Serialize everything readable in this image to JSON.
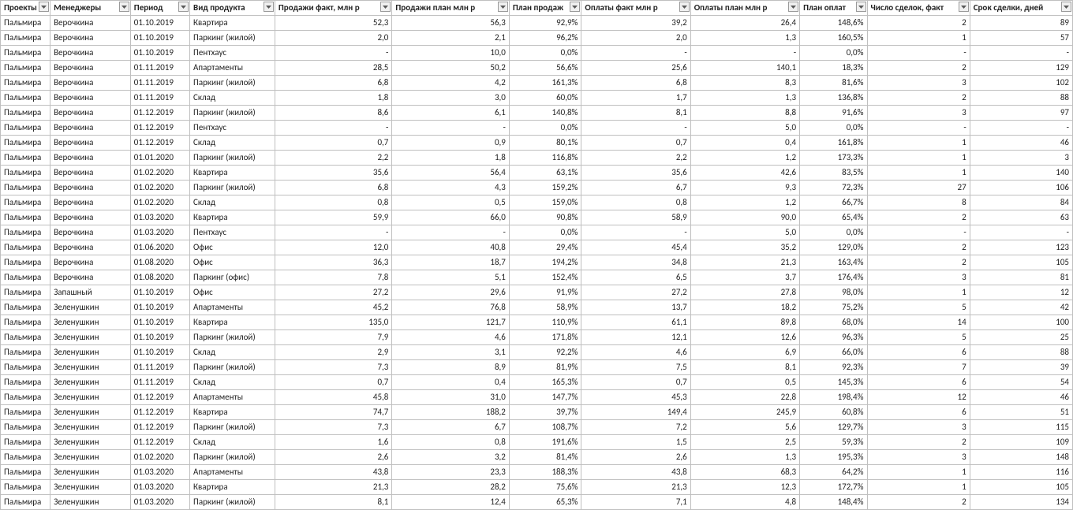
{
  "columns": [
    {
      "key": "project",
      "label": "Проекты",
      "align": "left"
    },
    {
      "key": "manager",
      "label": "Менеджеры",
      "align": "left"
    },
    {
      "key": "period",
      "label": "Период",
      "align": "left"
    },
    {
      "key": "product",
      "label": "Вид продукта",
      "align": "left"
    },
    {
      "key": "sales_fact",
      "label": "Продажи факт, млн р",
      "align": "right"
    },
    {
      "key": "sales_plan",
      "label": "Продажи план млн р",
      "align": "right"
    },
    {
      "key": "sales_pct",
      "label": "План продаж",
      "align": "right"
    },
    {
      "key": "pay_fact",
      "label": "Оплаты факт млн р",
      "align": "right"
    },
    {
      "key": "pay_plan",
      "label": "Оплаты план млн р",
      "align": "right"
    },
    {
      "key": "pay_pct",
      "label": "План оплат",
      "align": "right"
    },
    {
      "key": "deals",
      "label": "Число сделок, факт",
      "align": "right"
    },
    {
      "key": "days",
      "label": "Срок сделки, дней",
      "align": "right"
    }
  ],
  "rows": [
    {
      "project": "Пальмира",
      "manager": "Верочкина",
      "period": "01.10.2019",
      "product": "Квартира",
      "sales_fact": "52,3",
      "sales_plan": "56,3",
      "sales_pct": "92,9%",
      "pay_fact": "39,2",
      "pay_plan": "26,4",
      "pay_pct": "148,6%",
      "deals": "2",
      "days": "89"
    },
    {
      "project": "Пальмира",
      "manager": "Верочкина",
      "period": "01.10.2019",
      "product": "Паркинг (жилой)",
      "sales_fact": "2,0",
      "sales_plan": "2,1",
      "sales_pct": "96,2%",
      "pay_fact": "2,0",
      "pay_plan": "1,3",
      "pay_pct": "160,5%",
      "deals": "1",
      "days": "57"
    },
    {
      "project": "Пальмира",
      "manager": "Верочкина",
      "period": "01.10.2019",
      "product": "Пентхаус",
      "sales_fact": "-",
      "sales_plan": "10,0",
      "sales_pct": "0,0%",
      "pay_fact": "-",
      "pay_plan": "-",
      "pay_pct": "0,0%",
      "deals": "-",
      "days": "-"
    },
    {
      "project": "Пальмира",
      "manager": "Верочкина",
      "period": "01.11.2019",
      "product": "Апартаменты",
      "sales_fact": "28,5",
      "sales_plan": "50,2",
      "sales_pct": "56,6%",
      "pay_fact": "25,6",
      "pay_plan": "140,1",
      "pay_pct": "18,3%",
      "deals": "2",
      "days": "129"
    },
    {
      "project": "Пальмира",
      "manager": "Верочкина",
      "period": "01.11.2019",
      "product": "Паркинг (жилой)",
      "sales_fact": "6,8",
      "sales_plan": "4,2",
      "sales_pct": "161,3%",
      "pay_fact": "6,8",
      "pay_plan": "8,3",
      "pay_pct": "81,6%",
      "deals": "3",
      "days": "102"
    },
    {
      "project": "Пальмира",
      "manager": "Верочкина",
      "period": "01.11.2019",
      "product": "Склад",
      "sales_fact": "1,8",
      "sales_plan": "3,0",
      "sales_pct": "60,0%",
      "pay_fact": "1,7",
      "pay_plan": "1,3",
      "pay_pct": "136,8%",
      "deals": "2",
      "days": "88"
    },
    {
      "project": "Пальмира",
      "manager": "Верочкина",
      "period": "01.12.2019",
      "product": "Паркинг (жилой)",
      "sales_fact": "8,6",
      "sales_plan": "6,1",
      "sales_pct": "140,8%",
      "pay_fact": "8,1",
      "pay_plan": "8,8",
      "pay_pct": "91,6%",
      "deals": "3",
      "days": "97"
    },
    {
      "project": "Пальмира",
      "manager": "Верочкина",
      "period": "01.12.2019",
      "product": "Пентхаус",
      "sales_fact": "-",
      "sales_plan": "-",
      "sales_pct": "0,0%",
      "pay_fact": "-",
      "pay_plan": "5,0",
      "pay_pct": "0,0%",
      "deals": "-",
      "days": "-"
    },
    {
      "project": "Пальмира",
      "manager": "Верочкина",
      "period": "01.12.2019",
      "product": "Склад",
      "sales_fact": "0,7",
      "sales_plan": "0,9",
      "sales_pct": "80,1%",
      "pay_fact": "0,7",
      "pay_plan": "0,4",
      "pay_pct": "161,8%",
      "deals": "1",
      "days": "46"
    },
    {
      "project": "Пальмира",
      "manager": "Верочкина",
      "period": "01.01.2020",
      "product": "Паркинг (жилой)",
      "sales_fact": "2,2",
      "sales_plan": "1,8",
      "sales_pct": "116,8%",
      "pay_fact": "2,2",
      "pay_plan": "1,2",
      "pay_pct": "173,3%",
      "deals": "1",
      "days": "3"
    },
    {
      "project": "Пальмира",
      "manager": "Верочкина",
      "period": "01.02.2020",
      "product": "Квартира",
      "sales_fact": "35,6",
      "sales_plan": "56,4",
      "sales_pct": "63,1%",
      "pay_fact": "35,6",
      "pay_plan": "42,6",
      "pay_pct": "83,5%",
      "deals": "1",
      "days": "140"
    },
    {
      "project": "Пальмира",
      "manager": "Верочкина",
      "period": "01.02.2020",
      "product": "Паркинг (жилой)",
      "sales_fact": "6,8",
      "sales_plan": "4,3",
      "sales_pct": "159,2%",
      "pay_fact": "6,7",
      "pay_plan": "9,3",
      "pay_pct": "72,3%",
      "deals": "27",
      "days": "106"
    },
    {
      "project": "Пальмира",
      "manager": "Верочкина",
      "period": "01.02.2020",
      "product": "Склад",
      "sales_fact": "0,8",
      "sales_plan": "0,5",
      "sales_pct": "159,0%",
      "pay_fact": "0,8",
      "pay_plan": "1,2",
      "pay_pct": "66,7%",
      "deals": "8",
      "days": "84"
    },
    {
      "project": "Пальмира",
      "manager": "Верочкина",
      "period": "01.03.2020",
      "product": "Квартира",
      "sales_fact": "59,9",
      "sales_plan": "66,0",
      "sales_pct": "90,8%",
      "pay_fact": "58,9",
      "pay_plan": "90,0",
      "pay_pct": "65,4%",
      "deals": "2",
      "days": "63"
    },
    {
      "project": "Пальмира",
      "manager": "Верочкина",
      "period": "01.03.2020",
      "product": "Пентхаус",
      "sales_fact": "-",
      "sales_plan": "-",
      "sales_pct": "0,0%",
      "pay_fact": "-",
      "pay_plan": "5,0",
      "pay_pct": "0,0%",
      "deals": "-",
      "days": "-"
    },
    {
      "project": "Пальмира",
      "manager": "Верочкина",
      "period": "01.06.2020",
      "product": "Офис",
      "sales_fact": "12,0",
      "sales_plan": "40,8",
      "sales_pct": "29,4%",
      "pay_fact": "45,4",
      "pay_plan": "35,2",
      "pay_pct": "129,0%",
      "deals": "2",
      "days": "123"
    },
    {
      "project": "Пальмира",
      "manager": "Верочкина",
      "period": "01.08.2020",
      "product": "Офис",
      "sales_fact": "36,3",
      "sales_plan": "18,7",
      "sales_pct": "194,2%",
      "pay_fact": "34,8",
      "pay_plan": "21,3",
      "pay_pct": "163,4%",
      "deals": "2",
      "days": "105"
    },
    {
      "project": "Пальмира",
      "manager": "Верочкина",
      "period": "01.08.2020",
      "product": "Паркинг (офис)",
      "sales_fact": "7,8",
      "sales_plan": "5,1",
      "sales_pct": "152,4%",
      "pay_fact": "6,5",
      "pay_plan": "3,7",
      "pay_pct": "176,4%",
      "deals": "3",
      "days": "81"
    },
    {
      "project": "Пальмира",
      "manager": "Запашный",
      "period": "01.10.2019",
      "product": "Офис",
      "sales_fact": "27,2",
      "sales_plan": "29,6",
      "sales_pct": "91,9%",
      "pay_fact": "27,2",
      "pay_plan": "27,8",
      "pay_pct": "98,0%",
      "deals": "1",
      "days": "12"
    },
    {
      "project": "Пальмира",
      "manager": "Зеленушкин",
      "period": "01.10.2019",
      "product": "Апартаменты",
      "sales_fact": "45,2",
      "sales_plan": "76,8",
      "sales_pct": "58,9%",
      "pay_fact": "13,7",
      "pay_plan": "18,2",
      "pay_pct": "75,2%",
      "deals": "5",
      "days": "42"
    },
    {
      "project": "Пальмира",
      "manager": "Зеленушкин",
      "period": "01.10.2019",
      "product": "Квартира",
      "sales_fact": "135,0",
      "sales_plan": "121,7",
      "sales_pct": "110,9%",
      "pay_fact": "61,1",
      "pay_plan": "89,8",
      "pay_pct": "68,0%",
      "deals": "14",
      "days": "100"
    },
    {
      "project": "Пальмира",
      "manager": "Зеленушкин",
      "period": "01.10.2019",
      "product": "Паркинг (жилой)",
      "sales_fact": "7,9",
      "sales_plan": "4,6",
      "sales_pct": "171,8%",
      "pay_fact": "12,1",
      "pay_plan": "12,6",
      "pay_pct": "96,3%",
      "deals": "5",
      "days": "25"
    },
    {
      "project": "Пальмира",
      "manager": "Зеленушкин",
      "period": "01.10.2019",
      "product": "Склад",
      "sales_fact": "2,9",
      "sales_plan": "3,1",
      "sales_pct": "92,2%",
      "pay_fact": "4,6",
      "pay_plan": "6,9",
      "pay_pct": "66,0%",
      "deals": "6",
      "days": "88"
    },
    {
      "project": "Пальмира",
      "manager": "Зеленушкин",
      "period": "01.11.2019",
      "product": "Паркинг (жилой)",
      "sales_fact": "7,3",
      "sales_plan": "8,9",
      "sales_pct": "81,9%",
      "pay_fact": "7,5",
      "pay_plan": "8,1",
      "pay_pct": "92,3%",
      "deals": "7",
      "days": "39"
    },
    {
      "project": "Пальмира",
      "manager": "Зеленушкин",
      "period": "01.11.2019",
      "product": "Склад",
      "sales_fact": "0,7",
      "sales_plan": "0,4",
      "sales_pct": "165,3%",
      "pay_fact": "0,7",
      "pay_plan": "0,5",
      "pay_pct": "145,3%",
      "deals": "6",
      "days": "54"
    },
    {
      "project": "Пальмира",
      "manager": "Зеленушкин",
      "period": "01.12.2019",
      "product": "Апартаменты",
      "sales_fact": "45,8",
      "sales_plan": "31,0",
      "sales_pct": "147,7%",
      "pay_fact": "45,3",
      "pay_plan": "22,8",
      "pay_pct": "198,4%",
      "deals": "12",
      "days": "46"
    },
    {
      "project": "Пальмира",
      "manager": "Зеленушкин",
      "period": "01.12.2019",
      "product": "Квартира",
      "sales_fact": "74,7",
      "sales_plan": "188,2",
      "sales_pct": "39,7%",
      "pay_fact": "149,4",
      "pay_plan": "245,9",
      "pay_pct": "60,8%",
      "deals": "6",
      "days": "51"
    },
    {
      "project": "Пальмира",
      "manager": "Зеленушкин",
      "period": "01.12.2019",
      "product": "Паркинг (жилой)",
      "sales_fact": "7,3",
      "sales_plan": "6,7",
      "sales_pct": "108,7%",
      "pay_fact": "7,2",
      "pay_plan": "5,6",
      "pay_pct": "129,7%",
      "deals": "3",
      "days": "115"
    },
    {
      "project": "Пальмира",
      "manager": "Зеленушкин",
      "period": "01.12.2019",
      "product": "Склад",
      "sales_fact": "1,6",
      "sales_plan": "0,8",
      "sales_pct": "191,6%",
      "pay_fact": "1,5",
      "pay_plan": "2,5",
      "pay_pct": "59,3%",
      "deals": "2",
      "days": "109"
    },
    {
      "project": "Пальмира",
      "manager": "Зеленушкин",
      "period": "01.02.2020",
      "product": "Паркинг (жилой)",
      "sales_fact": "2,6",
      "sales_plan": "3,2",
      "sales_pct": "81,4%",
      "pay_fact": "2,6",
      "pay_plan": "1,3",
      "pay_pct": "195,3%",
      "deals": "3",
      "days": "148"
    },
    {
      "project": "Пальмира",
      "manager": "Зеленушкин",
      "period": "01.03.2020",
      "product": "Апартаменты",
      "sales_fact": "43,8",
      "sales_plan": "23,3",
      "sales_pct": "188,3%",
      "pay_fact": "43,8",
      "pay_plan": "68,3",
      "pay_pct": "64,2%",
      "deals": "1",
      "days": "116"
    },
    {
      "project": "Пальмира",
      "manager": "Зеленушкин",
      "period": "01.03.2020",
      "product": "Квартира",
      "sales_fact": "21,3",
      "sales_plan": "28,2",
      "sales_pct": "75,6%",
      "pay_fact": "21,3",
      "pay_plan": "12,3",
      "pay_pct": "172,7%",
      "deals": "1",
      "days": "105"
    },
    {
      "project": "Пальмира",
      "manager": "Зеленушкин",
      "period": "01.03.2020",
      "product": "Паркинг (жилой)",
      "sales_fact": "8,1",
      "sales_plan": "12,4",
      "sales_pct": "65,3%",
      "pay_fact": "7,1",
      "pay_plan": "4,8",
      "pay_pct": "148,4%",
      "deals": "2",
      "days": "134"
    }
  ]
}
